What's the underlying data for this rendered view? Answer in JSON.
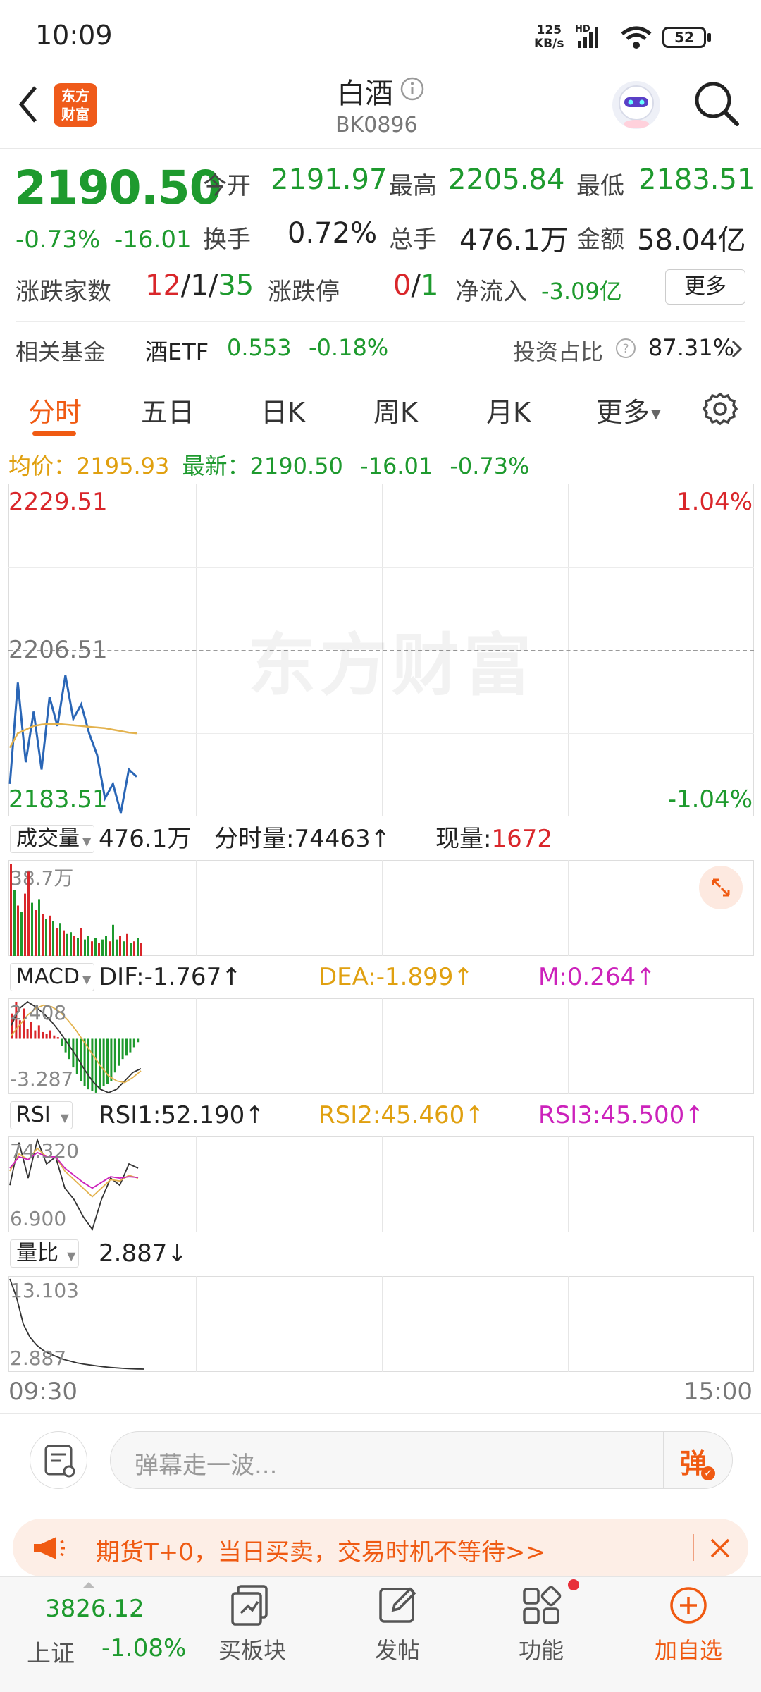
{
  "status": {
    "time": "10:09",
    "net_speed_top": "125",
    "net_speed_bottom": "KB/s",
    "network_label": "HD",
    "battery": "52"
  },
  "header": {
    "title": "白酒",
    "code": "BK0896",
    "logo_line1": "东方",
    "logo_line2": "财富"
  },
  "quote": {
    "price": "2190.50",
    "change_pct": "-0.73%",
    "change": "-16.01",
    "open_label": "今开",
    "open": "2191.97",
    "high_label": "最高",
    "high": "2205.84",
    "low_label": "最低",
    "low": "2183.51",
    "turnover_label": "换手",
    "turnover": "0.72%",
    "volume_label": "总手",
    "volume": "476.1万",
    "amount_label": "金额",
    "amount": "58.04亿",
    "updown_label": "涨跌家数",
    "up": "12",
    "flat": "1",
    "down": "35",
    "limit_label": "涨跌停",
    "limit_up": "0",
    "limit_down": "1",
    "netflow_label": "净流入",
    "netflow": "-3.09亿",
    "more_button": "更多"
  },
  "fund": {
    "label": "相关基金",
    "name": "酒ETF",
    "price": "0.553",
    "change": "-0.18%",
    "ratio_label": "投资占比",
    "ratio": "87.31%"
  },
  "tabs": [
    "分时",
    "五日",
    "日K",
    "周K",
    "月K",
    "更多"
  ],
  "chart_header": {
    "avg_label": "均价：",
    "avg": "2195.93",
    "last_label": "最新：",
    "last": "2190.50",
    "change": "-16.01",
    "change_pct": "-0.73%"
  },
  "chart_data": [
    {
      "type": "line",
      "title": "分时",
      "x_labels": [
        "09:30",
        "15:00"
      ],
      "y_axis_labels": [
        "2229.51",
        "2206.51",
        "2183.51"
      ],
      "right_axis_labels": [
        "1.04%",
        "-1.04%"
      ],
      "ylim": [
        2183.51,
        2229.51
      ],
      "watermark": "东方财富",
      "series": [
        {
          "name": "最新",
          "color": "#2a66b6",
          "values": [
            2188,
            2202,
            2191,
            2198,
            2190,
            2200,
            2196,
            2203,
            2197,
            2199,
            2195,
            2192,
            2186,
            2188,
            2184,
            2190,
            2189
          ]
        },
        {
          "name": "均价",
          "color": "#e3b24d",
          "values": [
            2193,
            2195,
            2195.5,
            2196,
            2196.2,
            2196.3,
            2196.3,
            2196.2,
            2196.1,
            2196,
            2195.9,
            2195.8,
            2195.7,
            2195.5,
            2195.3,
            2195.1,
            2195
          ]
        }
      ]
    },
    {
      "type": "bar",
      "title": "成交量",
      "summary": "476.1万",
      "minute_label": "分时量:",
      "minute": "74463",
      "now_label": "现量:",
      "now": "1672",
      "max_label": "38.7万",
      "values": [
        100,
        72,
        55,
        48,
        68,
        92,
        58,
        50,
        62,
        46,
        40,
        44,
        38,
        30,
        36,
        28,
        24,
        26,
        22,
        20,
        30,
        18,
        22,
        16,
        20,
        14,
        18,
        22,
        16,
        34,
        18,
        22,
        16,
        24,
        14,
        16,
        20,
        14
      ],
      "colors": [
        "r",
        "g",
        "r",
        "g",
        "r",
        "r",
        "g",
        "r",
        "g",
        "r",
        "g",
        "r",
        "g",
        "r",
        "g",
        "r",
        "g",
        "g",
        "r",
        "g",
        "r",
        "g",
        "g",
        "r",
        "g",
        "r",
        "g",
        "g",
        "r",
        "g",
        "g",
        "r",
        "g",
        "r",
        "g",
        "r",
        "g",
        "r"
      ]
    },
    {
      "type": "bar",
      "title": "MACD",
      "dif_label": "DIF:",
      "dif": "-1.767",
      "dea_label": "DEA:",
      "dea": "-1.899",
      "m_label": "M:",
      "m": "0.264",
      "ylim": [
        -3.287,
        2.408
      ],
      "axis_labels": [
        "2.408",
        "-3.287"
      ],
      "values": [
        1.5,
        2.2,
        1.1,
        1.8,
        0.6,
        1.0,
        0.5,
        0.8,
        0.4,
        0.3,
        0.5,
        0.2,
        0.1,
        -0.4,
        -0.8,
        -1.2,
        -1.7,
        -2.1,
        -2.5,
        -2.8,
        -3.0,
        -3.1,
        -3.2,
        -3.0,
        -2.8,
        -2.7,
        -2.5,
        -2.0,
        -1.6,
        -1.2,
        -1.0,
        -0.8,
        -0.5,
        -0.2
      ]
    },
    {
      "type": "line",
      "title": "RSI",
      "rsi1_label": "RSI1:",
      "rsi1": "52.190",
      "rsi2_label": "RSI2:",
      "rsi2": "45.460",
      "rsi3_label": "RSI3:",
      "rsi3": "45.500",
      "ylim": [
        6.9,
        74.32
      ],
      "axis_labels": [
        "74.320",
        "6.900"
      ]
    },
    {
      "type": "line",
      "title": "量比",
      "value": "2.887",
      "ylim": [
        2.887,
        13.103
      ],
      "axis_labels": [
        "13.103",
        "2.887"
      ]
    }
  ],
  "comment": {
    "placeholder": "弹幕走一波...",
    "danmu_label": "弹"
  },
  "banner": {
    "text": "期货T+0，当日买卖，交易时机不等待>>"
  },
  "bottom": {
    "index_value": "3826.12",
    "index_name": "上证",
    "index_change": "-1.08%",
    "nav": [
      "买板块",
      "发帖",
      "功能",
      "加自选"
    ]
  },
  "colors": {
    "red": "#d9262a",
    "green": "#1e9a2e",
    "accent": "#f05a12",
    "line": "#2a66b6",
    "avg": "#e3b24d"
  }
}
